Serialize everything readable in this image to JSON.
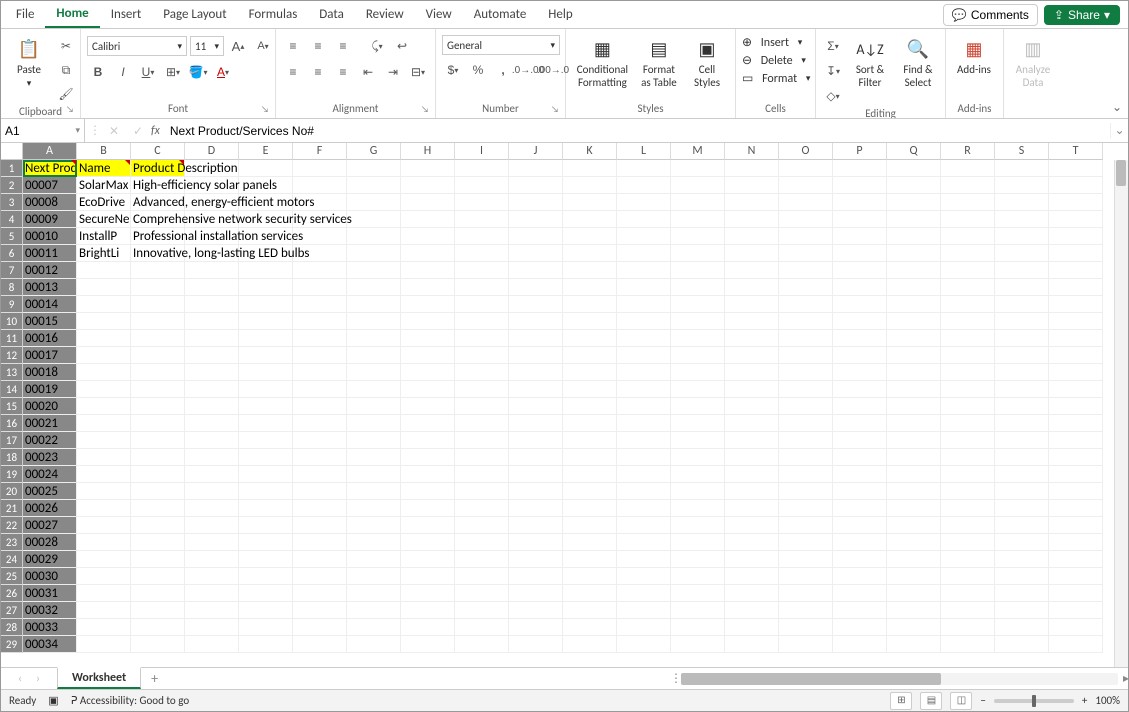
{
  "tabs": [
    "File",
    "Home",
    "Insert",
    "Page Layout",
    "Formulas",
    "Data",
    "Review",
    "View",
    "Automate",
    "Help"
  ],
  "active_tab_index": 1,
  "header_right": {
    "comments": "Comments",
    "share": "Share"
  },
  "ribbon": {
    "clipboard": {
      "label": "Clipboard",
      "paste": "Paste"
    },
    "font": {
      "label": "Font",
      "family": "Calibri",
      "size": "11"
    },
    "alignment": {
      "label": "Alignment"
    },
    "number": {
      "label": "Number",
      "format": "General"
    },
    "styles": {
      "label": "Styles",
      "cf": "Conditional Formatting",
      "fat": "Format as Table",
      "cs": "Cell Styles"
    },
    "cells": {
      "label": "Cells",
      "insert": "Insert",
      "delete": "Delete",
      "format": "Format"
    },
    "editing": {
      "label": "Editing",
      "sort": "Sort & Filter",
      "find": "Find & Select"
    },
    "addins": {
      "label": "Add-ins",
      "btn": "Add-ins"
    },
    "analyze": {
      "label": "",
      "btn": "Analyze Data"
    }
  },
  "name_box": "A1",
  "formula_text": "Next Product/Services No#",
  "columns": [
    "A",
    "B",
    "C",
    "D",
    "E",
    "F",
    "G",
    "H",
    "I",
    "J",
    "K",
    "L",
    "M",
    "N",
    "O",
    "P",
    "Q",
    "R",
    "S",
    "T"
  ],
  "row_count": 29,
  "grid_headers": {
    "A": "Next Product/Services No#",
    "B": "Name",
    "C": "Product Description"
  },
  "grid_rows": [
    {
      "a": "00007",
      "b": "SolarMax",
      "c": "High-efficiency solar panels"
    },
    {
      "a": "00008",
      "b": "EcoDrive Motors",
      "c": "Advanced, energy-efficient motors"
    },
    {
      "a": "00009",
      "b": "SecureNet",
      "c": "Comprehensive network security services"
    },
    {
      "a": "00010",
      "b": "InstallPro",
      "c": "Professional installation services"
    },
    {
      "a": "00011",
      "b": "BrightLite",
      "c": "Innovative, long-lasting LED bulbs"
    }
  ],
  "col_a_series": [
    "00012",
    "00013",
    "00014",
    "00015",
    "00016",
    "00017",
    "00018",
    "00019",
    "00020",
    "00021",
    "00022",
    "00023",
    "00024",
    "00025",
    "00026",
    "00027",
    "00028",
    "00029",
    "00030",
    "00031",
    "00032",
    "00033",
    "00034"
  ],
  "sheet_tab": "Worksheet",
  "status": {
    "ready": "Ready",
    "accessibility": "Accessibility: Good to go",
    "zoom": "100%"
  }
}
